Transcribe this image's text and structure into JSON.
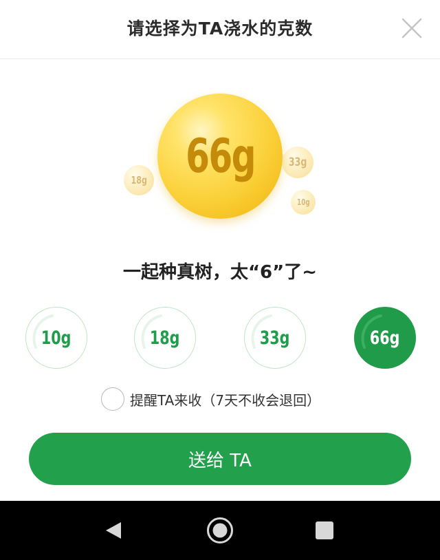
{
  "header": {
    "title": "请选择为TA浇水的克数",
    "close_icon": "close-icon"
  },
  "orbs": {
    "main_label": "66g",
    "side_labels": [
      "18g",
      "33g",
      "10g"
    ],
    "main_color": "#f7c52a"
  },
  "slogan": "一起种真树，太“6”了~",
  "options": [
    {
      "label": "10g",
      "selected": false
    },
    {
      "label": "18g",
      "selected": false
    },
    {
      "label": "33g",
      "selected": false
    },
    {
      "label": "66g",
      "selected": true
    }
  ],
  "remind": {
    "label": "提醒TA来收（7天不收会退回）",
    "checked": false
  },
  "send_button": {
    "label": "送给 TA"
  },
  "colors": {
    "accent": "#22a04c",
    "option_text": "#1e9e4a",
    "option_border": "#bfe6c6"
  },
  "navbar": {
    "icons": [
      "back-icon",
      "home-icon",
      "recent-apps-icon"
    ]
  }
}
